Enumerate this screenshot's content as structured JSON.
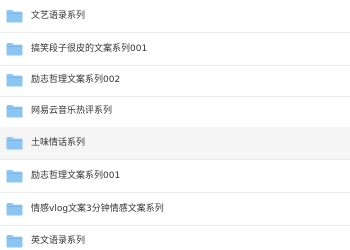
{
  "folder_list": {
    "items": [
      {
        "name": "文艺语录系列",
        "icon": "folder-icon"
      },
      {
        "name": "搞笑段子很皮的文案系列001",
        "icon": "folder-icon"
      },
      {
        "name": "励志哲理文案系列002",
        "icon": "folder-icon"
      },
      {
        "name": "网易云音乐热评系列",
        "icon": "folder-icon"
      },
      {
        "name": "土味情话系列",
        "icon": "folder-icon",
        "highlighted": true
      },
      {
        "name": "励志哲理文案系列001",
        "icon": "folder-icon"
      },
      {
        "name": "情感vlog文案3分钟情感文案系列",
        "icon": "folder-icon"
      },
      {
        "name": "英文语录系列",
        "icon": "folder-icon"
      }
    ]
  },
  "colors": {
    "folder_icon": "#8cc4f2",
    "folder_icon_dark": "#6faedf",
    "text": "#333333",
    "divider": "#ececec",
    "highlight_row": "#f5f5f5"
  }
}
